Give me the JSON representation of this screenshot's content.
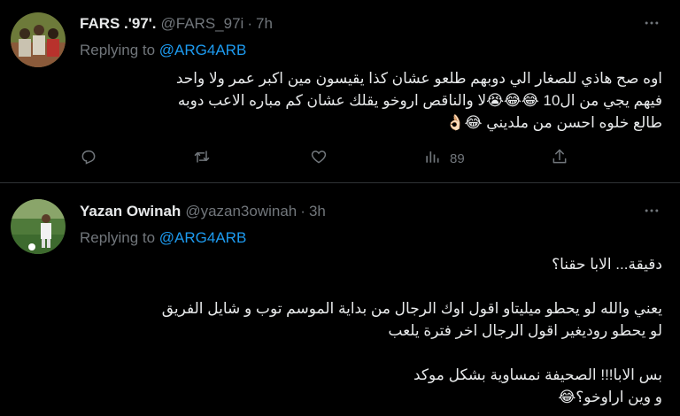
{
  "tweets": [
    {
      "display_name": "FARS .'97'.",
      "handle": "@FARS_97i",
      "time": "7h",
      "replying_prefix": "Replying to",
      "replying_to": "@ARG4ARB",
      "text": "اوه صح هاذي للصغار الي دوبهم طلعو عشان كذا يقيسون مين اكبر عمر ولا واحد\nفيهم يجي من ال10 😂😂😭لا والناقص اروخو يقلك عشان كم مباره الاعب دوبه\nطالع خلوه احسن من ملديني 😂👌🏻",
      "views": "89"
    },
    {
      "display_name": "Yazan Owinah",
      "handle": "@yazan3owinah",
      "time": "3h",
      "replying_prefix": "Replying to",
      "replying_to": "@ARG4ARB",
      "text": "دقيقة... الابا حقنا؟\n\nيعني والله لو يحطو ميليتاو اقول اوك الرجال من بداية الموسم توب و شايل الفريق\nلو يحطو روديغير اقول الرجال اخر فترة يلعب\n\nبس الابا!!! الصحيفة نمساوية بشكل موكد\nو وين اراوخو؟😂"
    }
  ],
  "icons": {
    "more": "more-horizontal-icon",
    "reply": "reply-icon",
    "retweet": "retweet-icon",
    "like": "heart-icon",
    "views": "views-icon",
    "share": "share-icon"
  },
  "colors": {
    "background": "#000000",
    "text": "#e7e9ea",
    "muted": "#71767b",
    "link": "#1d9bf0",
    "divider": "#2f3336"
  }
}
